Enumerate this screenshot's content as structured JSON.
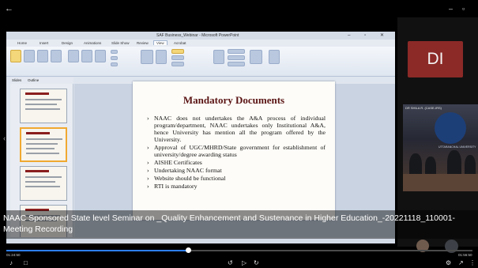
{
  "player": {
    "recording_title": "NAAC Sponsored State level Seminar on _Quality Enhancement and Sustenance in Higher Education_-20221118_110001-Meeting Recording",
    "time_elapsed": "01:24:50",
    "time_total": "01:56:50",
    "progress_fraction": 0.39,
    "window_min": "–",
    "window_max": "▫"
  },
  "participants": {
    "avatar_initials": "DI",
    "video_caption": "DR SHILA R. (CASE-IRS)",
    "banner_text": "UTTARANCHAL UNIVERSITY",
    "avatar_color": "#8c2a27"
  },
  "powerpoint": {
    "window_title": "SAF Business_Webinar - Microsoft PowerPoint",
    "tabs": [
      "Home",
      "Insert",
      "Design",
      "Animations",
      "Slide Show",
      "Review",
      "View",
      "Acrobat"
    ],
    "panel_tabs": [
      "Slides",
      "Outline"
    ],
    "slide": {
      "title": "Mandatory Documents",
      "bullets": [
        "NAAC does not undertakes the A&A process of individual program/department, NAAC undertakes only Institutional A&A, hence University has mention all the program offered by the University.",
        "Approval of UGC/MHRD/State government for establishment of university/degree awarding status",
        "AISHE Certificates",
        "Undertaking NAAC format",
        "Website should be functional",
        "RTI is mandatory"
      ]
    }
  },
  "colors": {
    "accent": "#2d7ff9",
    "slide_title": "#5a1414"
  }
}
